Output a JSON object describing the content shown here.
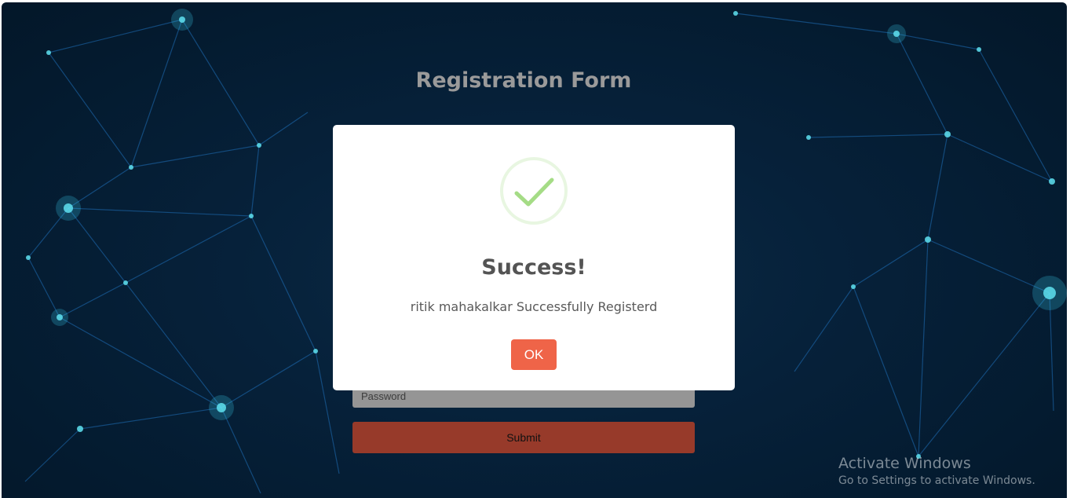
{
  "page": {
    "title": "Registration Form",
    "fields": {
      "password_placeholder": "Password"
    },
    "submit_label": "Submit"
  },
  "dialog": {
    "icon": "check-circle-icon",
    "title": "Success!",
    "message": "ritik mahakalkar Successfully Registerd",
    "ok_label": "OK"
  },
  "watermark": {
    "title": "Activate Windows",
    "subtitle": "Go to Settings to activate Windows."
  },
  "colors": {
    "background": "#06213a",
    "network_lines": "#1f6fb8",
    "network_nodes": "#5fe2f0",
    "submit_button": "#973a2a",
    "ok_button": "#ef6448",
    "success_check": "#a5dc86"
  }
}
